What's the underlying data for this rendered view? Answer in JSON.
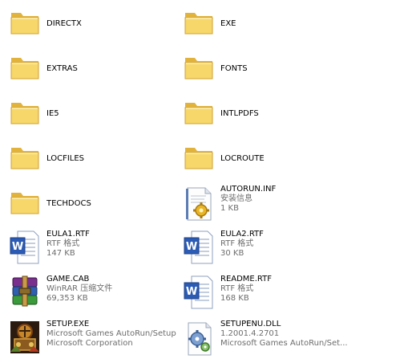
{
  "items": [
    {
      "name": "DIRECTX",
      "kind": "folder",
      "icon": "folder-icon"
    },
    {
      "name": "EXE",
      "kind": "folder",
      "icon": "folder-icon"
    },
    {
      "name": "EXTRAS",
      "kind": "folder",
      "icon": "folder-icon"
    },
    {
      "name": "FONTS",
      "kind": "folder",
      "icon": "folder-icon"
    },
    {
      "name": "IE5",
      "kind": "folder",
      "icon": "folder-icon"
    },
    {
      "name": "INTLPDFS",
      "kind": "folder",
      "icon": "folder-icon"
    },
    {
      "name": "LOCFILES",
      "kind": "folder",
      "icon": "folder-icon"
    },
    {
      "name": "LOCROUTE",
      "kind": "folder",
      "icon": "folder-icon"
    },
    {
      "name": "TECHDOCS",
      "kind": "folder",
      "icon": "folder-icon"
    },
    {
      "name": "AUTORUN.INF",
      "line2": "安装信息",
      "line3": "1 KB",
      "icon": "settings-file-icon"
    },
    {
      "name": "EULA1.RTF",
      "line2": "RTF 格式",
      "line3": "147 KB",
      "icon": "word-document-icon"
    },
    {
      "name": "EULA2.RTF",
      "line2": "RTF 格式",
      "line3": "30 KB",
      "icon": "word-document-icon"
    },
    {
      "name": "GAME.CAB",
      "line2": "WinRAR 压缩文件",
      "line3": "69,353 KB",
      "icon": "winrar-archive-icon"
    },
    {
      "name": "README.RTF",
      "line2": "RTF 格式",
      "line3": "168 KB",
      "icon": "word-document-icon"
    },
    {
      "name": "SETUP.EXE",
      "line2": "Microsoft Games AutoRun/Setup",
      "line3": "Microsoft Corporation",
      "icon": "setup-program-icon"
    },
    {
      "name": "SETUPENU.DLL",
      "line2": "1.2001.4.2701",
      "line3": "Microsoft Games AutoRun/Set...",
      "icon": "dll-gear-icon"
    }
  ],
  "colors": {
    "folder_fill": "#f7d76a",
    "folder_shade": "#e2b33c",
    "word_blue": "#2b5bb5",
    "secondary_text": "#6d6d6d"
  }
}
